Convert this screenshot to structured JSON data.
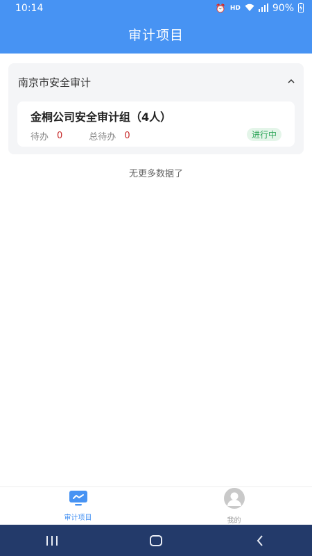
{
  "status_bar": {
    "time": "10:14",
    "battery": "90%",
    "icons": [
      "alarm-icon",
      "hd-icon",
      "wifi-icon",
      "signal-icon",
      "battery-charging-icon"
    ]
  },
  "header": {
    "title": "审计项目"
  },
  "group": {
    "title": "南京市安全审计",
    "expanded": true,
    "card": {
      "title": "金桐公司安全审计组（4人）",
      "todo_label": "待办",
      "todo_value": "0",
      "total_label": "总待办",
      "total_value": "0",
      "status": "进行中"
    }
  },
  "list_end_text": "无更多数据了",
  "tabbar": {
    "items": [
      {
        "label": "审计项目",
        "icon": "audit-project-icon",
        "active": true
      },
      {
        "label": "我的",
        "icon": "profile-icon",
        "active": false
      }
    ]
  },
  "nav": {
    "icons": [
      "recent-apps-icon",
      "home-icon",
      "back-icon"
    ]
  },
  "colors": {
    "primary": "#4793f3",
    "danger": "#c62828",
    "success": "#2fa65a",
    "nav_bg": "#233a6a"
  }
}
